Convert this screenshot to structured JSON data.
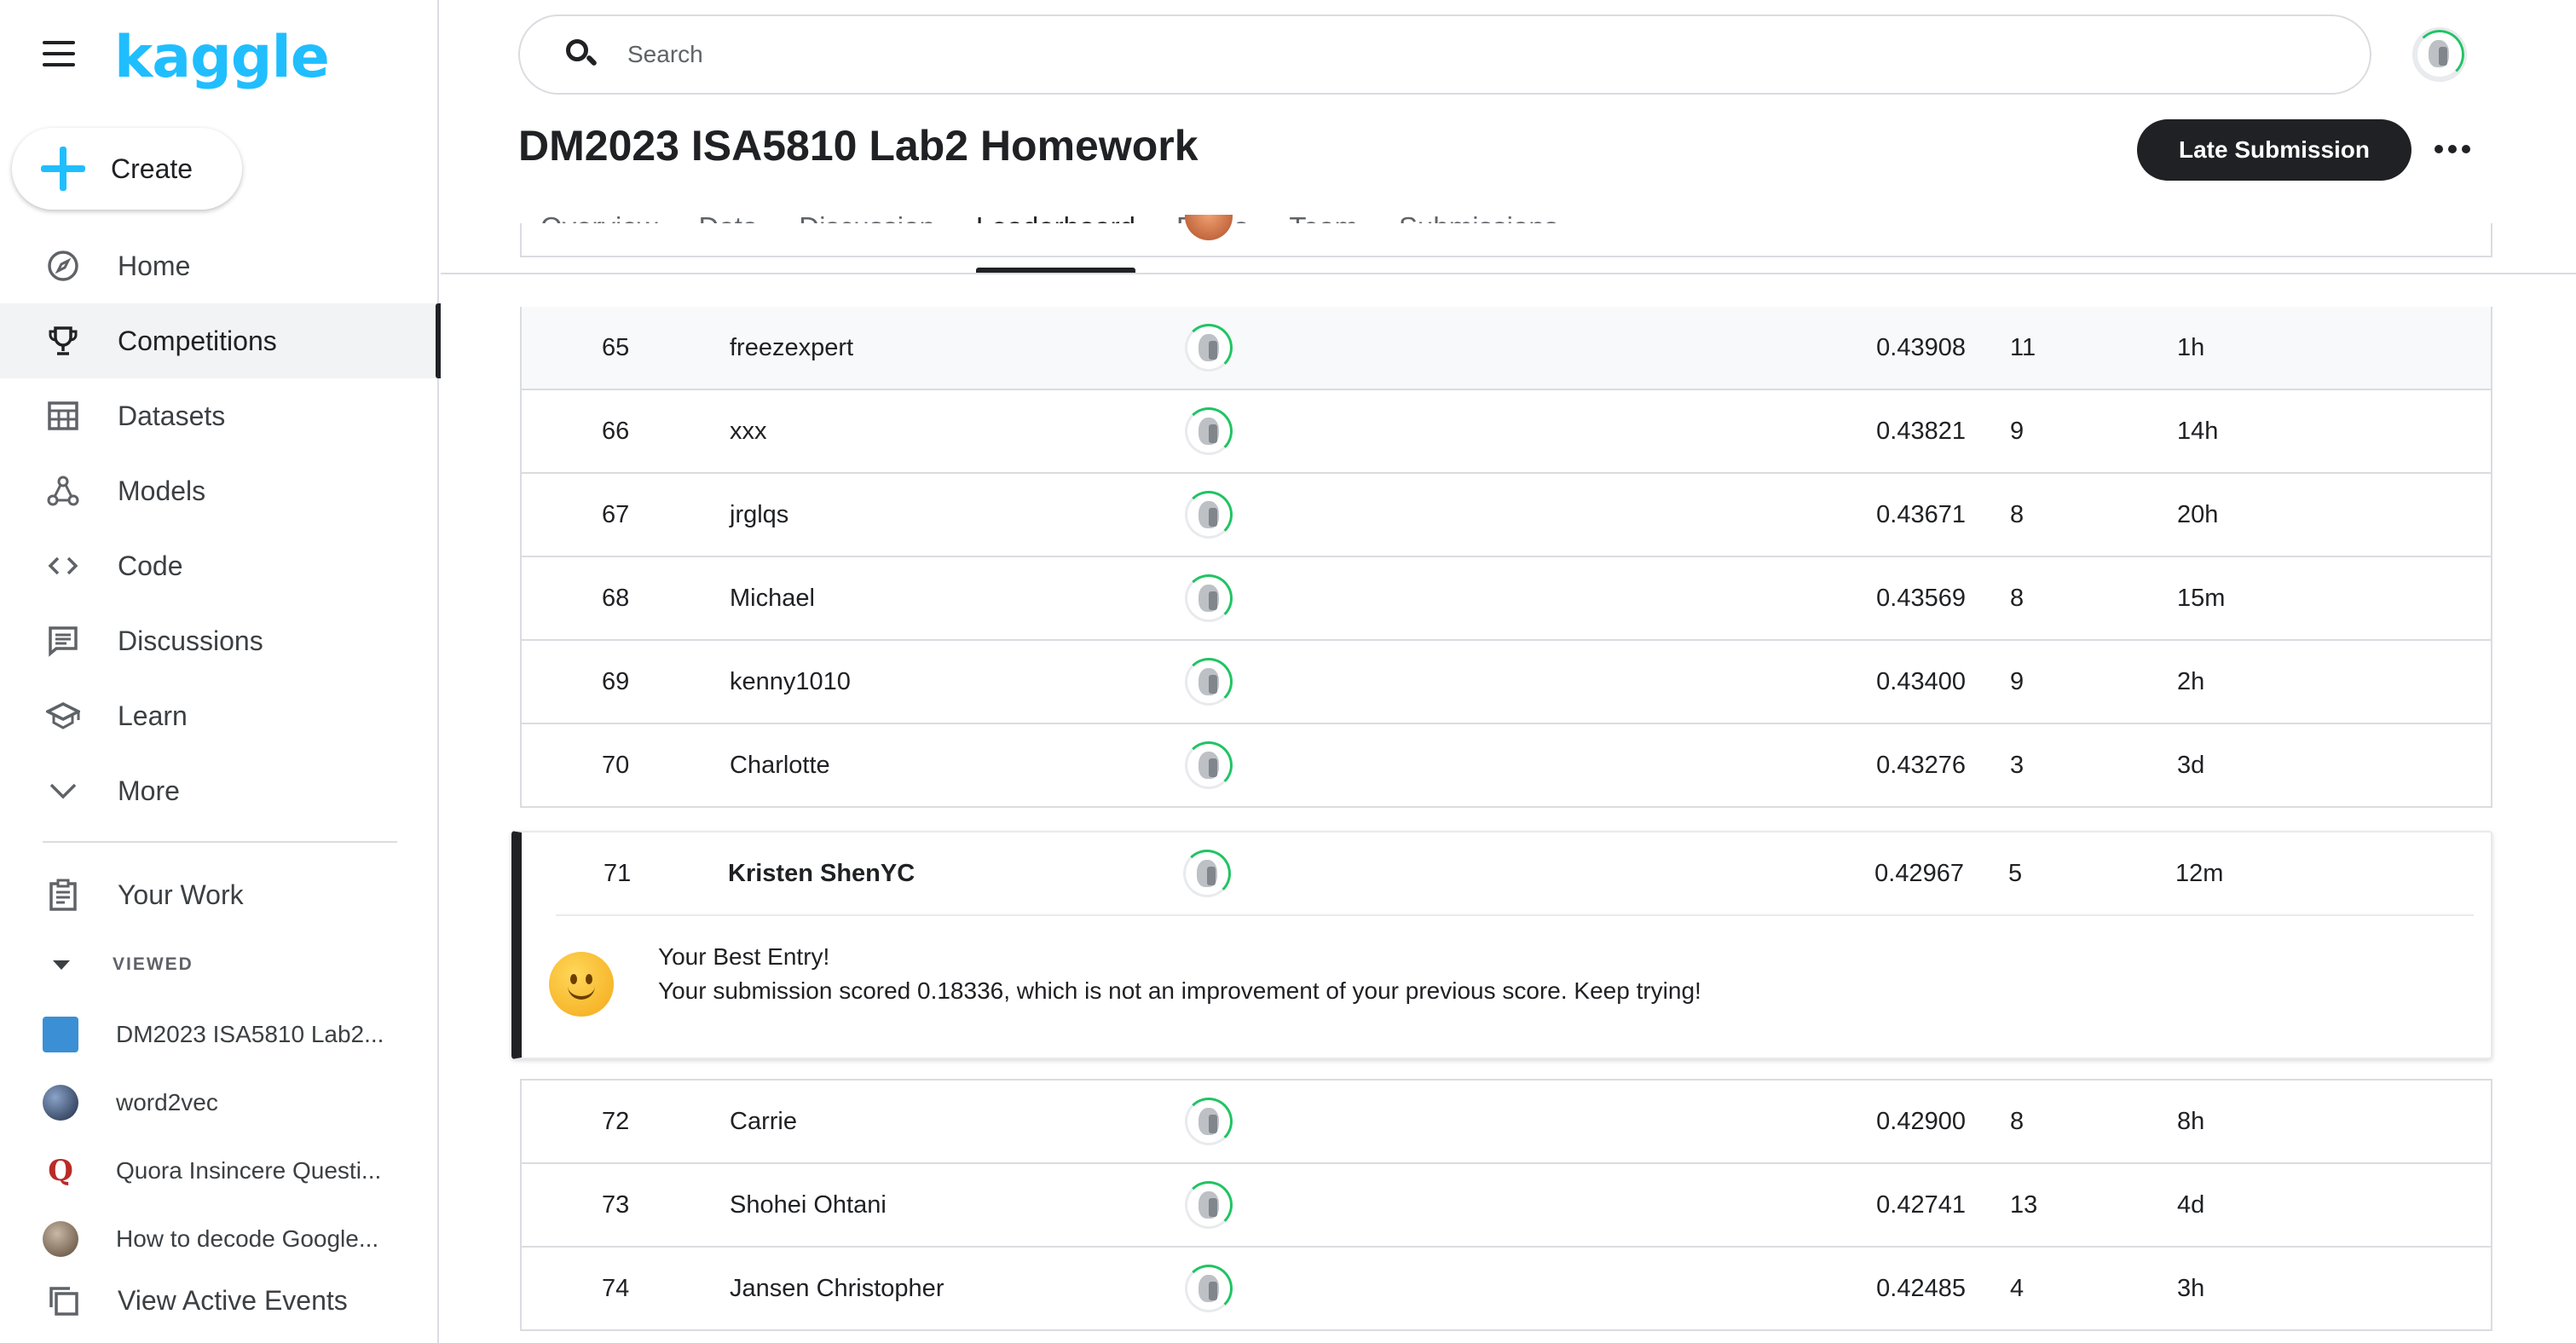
{
  "brand": {
    "logo_text": "kaggle",
    "accent": "#20beff"
  },
  "sidebar": {
    "create_label": "Create",
    "items": [
      {
        "label": "Home",
        "icon": "compass-icon"
      },
      {
        "label": "Competitions",
        "icon": "trophy-icon",
        "active": true
      },
      {
        "label": "Datasets",
        "icon": "table-icon"
      },
      {
        "label": "Models",
        "icon": "models-icon"
      },
      {
        "label": "Code",
        "icon": "code-icon"
      },
      {
        "label": "Discussions",
        "icon": "comments-icon"
      },
      {
        "label": "Learn",
        "icon": "school-icon"
      },
      {
        "label": "More",
        "icon": "chevron-down-icon"
      }
    ],
    "your_work": "Your Work",
    "viewed_heading": "VIEWED",
    "recent": [
      {
        "label": "DM2023 ISA5810 Lab2...",
        "icon": "competition-thumb-icon"
      },
      {
        "label": "word2vec",
        "icon": "user-avatar-icon"
      },
      {
        "label": "Quora Insincere Questi...",
        "icon": "quora-icon",
        "glyph": "Q"
      },
      {
        "label": "How to decode Google...",
        "icon": "user-avatar-icon"
      }
    ],
    "view_active_events": "View Active Events"
  },
  "header": {
    "search_placeholder": "Search",
    "title": "DM2023 ISA5810 Lab2 Homework",
    "late_submission": "Late Submission",
    "tabs": [
      {
        "label": "Overview"
      },
      {
        "label": "Data"
      },
      {
        "label": "Discussion"
      },
      {
        "label": "Leaderboard",
        "active": true
      },
      {
        "label": "Rules"
      },
      {
        "label": "Team"
      },
      {
        "label": "Submissions"
      }
    ]
  },
  "leaderboard": {
    "rows": [
      {
        "rank": "65",
        "name": "freezexpert",
        "score": "0.43908",
        "entries": "11",
        "last": "1h"
      },
      {
        "rank": "66",
        "name": "xxx",
        "score": "0.43821",
        "entries": "9",
        "last": "14h"
      },
      {
        "rank": "67",
        "name": "jrglqs",
        "score": "0.43671",
        "entries": "8",
        "last": "20h"
      },
      {
        "rank": "68",
        "name": "Michael",
        "score": "0.43569",
        "entries": "8",
        "last": "15m"
      },
      {
        "rank": "69",
        "name": "kenny1010",
        "score": "0.43400",
        "entries": "9",
        "last": "2h"
      },
      {
        "rank": "70",
        "name": "Charlotte",
        "score": "0.43276",
        "entries": "3",
        "last": "3d"
      }
    ],
    "best": {
      "rank": "71",
      "name": "Kristen ShenYC",
      "score": "0.42967",
      "entries": "5",
      "last": "12m",
      "title": "Your Best Entry!",
      "message": "Your submission scored 0.18336, which is not an improvement of your previous score. Keep trying!"
    },
    "rows_after": [
      {
        "rank": "72",
        "name": "Carrie",
        "score": "0.42900",
        "entries": "8",
        "last": "8h"
      },
      {
        "rank": "73",
        "name": "Shohei Ohtani",
        "score": "0.42741",
        "entries": "13",
        "last": "4d"
      },
      {
        "rank": "74",
        "name": "Jansen Christopher",
        "score": "0.42485",
        "entries": "4",
        "last": "3h"
      }
    ]
  }
}
